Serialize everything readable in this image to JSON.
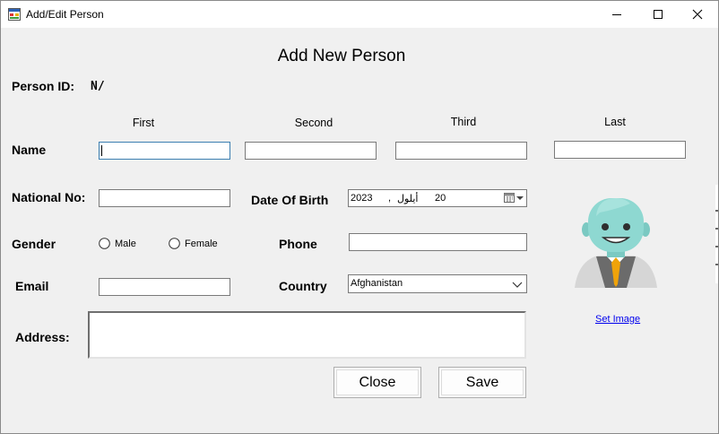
{
  "window": {
    "title": "Add/Edit Person"
  },
  "form": {
    "heading": "Add New Person",
    "person_id_label": "Person ID:",
    "person_id_value": "N/",
    "name_label": "Name",
    "name_columns": [
      "First",
      "Second",
      "Third",
      "Last"
    ],
    "first_name": "",
    "second_name": "",
    "third_name": "",
    "last_name": "",
    "national_no_label": "National No:",
    "national_no": "",
    "dob_label": "Date Of Birth",
    "dob": {
      "year": "2023",
      "comma": ",",
      "month": "أيلول",
      "day": "20"
    },
    "gender_label": "Gender",
    "gender_options": [
      "Male",
      "Female"
    ],
    "phone_label": "Phone",
    "phone": "",
    "email_label": "Email",
    "email": "",
    "country_label": "Country",
    "country_selected": "Afghanistan",
    "address_label": "Address:",
    "address": "",
    "set_image_label": "Set Image",
    "close_label": "Close",
    "save_label": "Save"
  },
  "icons": {
    "app": "form-icon",
    "minimize": "minimize-icon",
    "maximize": "maximize-icon",
    "close": "close-icon",
    "calendar": "calendar-icon",
    "dropdown": "chevron-down-icon",
    "avatar": "person-avatar"
  },
  "colors": {
    "window_bg": "#f0f0f0",
    "focus_border": "#3c7fb1",
    "link": "#0000ee",
    "avatar_head": "#8ed8d1",
    "avatar_tie": "#f0a30a"
  }
}
